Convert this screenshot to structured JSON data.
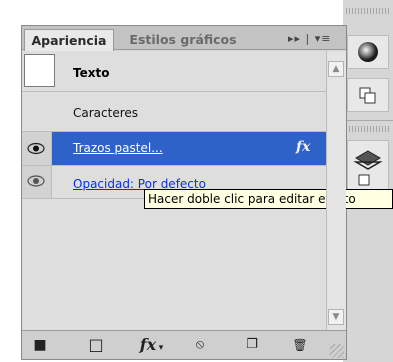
{
  "panel": {
    "tabs": [
      {
        "label": "Apariencia",
        "active": true
      },
      {
        "label": "Estilos gráficos",
        "active": false
      }
    ],
    "menu_glyphs": "▸▸ | ▾≡",
    "items": [
      {
        "label": "Texto",
        "type": "object-target",
        "swatch": "#ffffff"
      },
      {
        "label": "Caracteres",
        "type": "subgroup"
      },
      {
        "label": "Trazos pastel...",
        "type": "effect",
        "selected": true,
        "visible": true,
        "fx_label": "fx"
      },
      {
        "label": "Opacidad: Por defecto",
        "type": "attribute",
        "visible": true
      }
    ],
    "tooltip": "Hacer doble clic para editar efecto",
    "bottom_toolbar": [
      {
        "icon": "square-filled-icon",
        "glyph": "■"
      },
      {
        "icon": "square-outline-icon",
        "glyph": "□"
      },
      {
        "icon": "fx-icon",
        "glyph": "fx",
        "suffix": "▾"
      },
      {
        "icon": "clear-appearance-icon",
        "glyph": "⦸"
      },
      {
        "icon": "duplicate-item-icon",
        "glyph": "❐"
      },
      {
        "icon": "trash-icon",
        "glyph": "🗑"
      }
    ]
  },
  "dock": {
    "icons": [
      "gradient-circle-icon",
      "transform-icon",
      "layers-icon"
    ]
  },
  "colors": {
    "selection": "#2f62c8",
    "link_blue": "#0b2fd6",
    "tooltip_bg": "#ffffe1"
  }
}
